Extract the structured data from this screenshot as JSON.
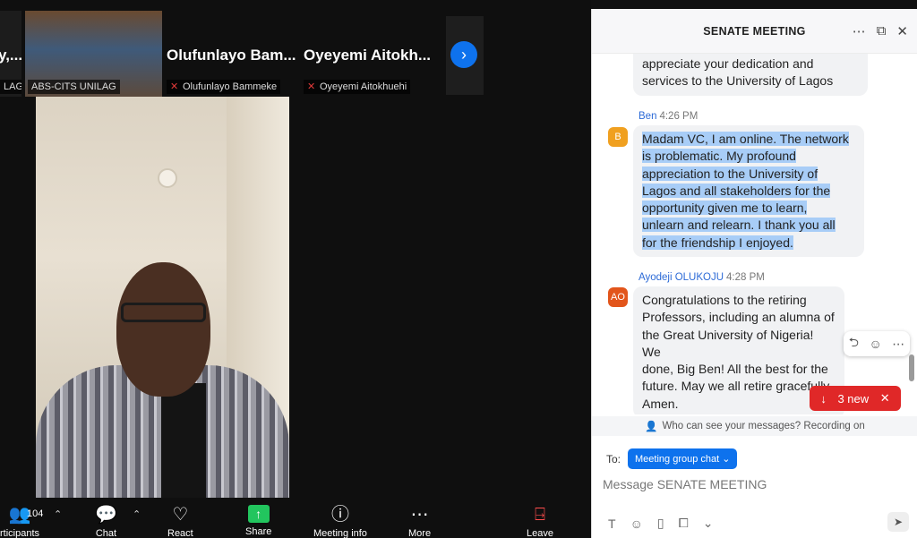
{
  "meeting": {
    "thumbnails": [
      {
        "name": "y,...",
        "label": "LAG"
      },
      {
        "name": "",
        "label": "ABS-CITS UNILAG"
      },
      {
        "name": "Olufunlayo  Bam...",
        "label": "Olufunlayo Bammeke"
      },
      {
        "name": "Oyeyemi  Aitokh...",
        "label": "Oyeyemi Aitokhuehi"
      }
    ],
    "next_icon": "chevron-right-icon"
  },
  "toolbar": {
    "participants_count": "104",
    "participants_label": "rticipants",
    "chat_label": "Chat",
    "react_label": "React",
    "share_label": "Share",
    "meeting_info_label": "Meeting info",
    "more_label": "More",
    "leave_label": "Leave"
  },
  "chat": {
    "title": "SENATE MEETING",
    "messages": [
      {
        "text_lines": [
          "appreciate your dedication and",
          "services to the University of Lagos"
        ]
      },
      {
        "sender": "Ben",
        "time": "4:26 PM",
        "avatar": "B",
        "avatar_color": "#f0a020",
        "text_lines": [
          "Madam VC, I am online. The network",
          "is problematic. My profound",
          "appreciation to the University of",
          "Lagos and all stakeholders for the",
          "opportunity given me to learn,",
          "unlearn and relearn. I thank you all",
          "for the friendship I enjoyed."
        ]
      },
      {
        "sender": "Ayodeji OLUKOJU",
        "time": "4:28 PM",
        "avatar": "AO",
        "avatar_color": "#e2551b",
        "text_lines": [
          "Congratulations to the retiring",
          "Professors, including an alumna of",
          "the Great University of Nigeria! We",
          "done, Big Ben! All the best for the",
          "future. May we all retire gracefully.",
          "Amen."
        ]
      }
    ],
    "new_messages": "3 new",
    "privacy_text": "Who can see your messages? Recording on",
    "to_label": "To:",
    "recipient": "Meeting group chat",
    "input_placeholder": "Message SENATE MEETING"
  },
  "colors": {
    "accent": "#0e72ed",
    "alert": "#e02828",
    "highlight": "#a8cdf7"
  }
}
